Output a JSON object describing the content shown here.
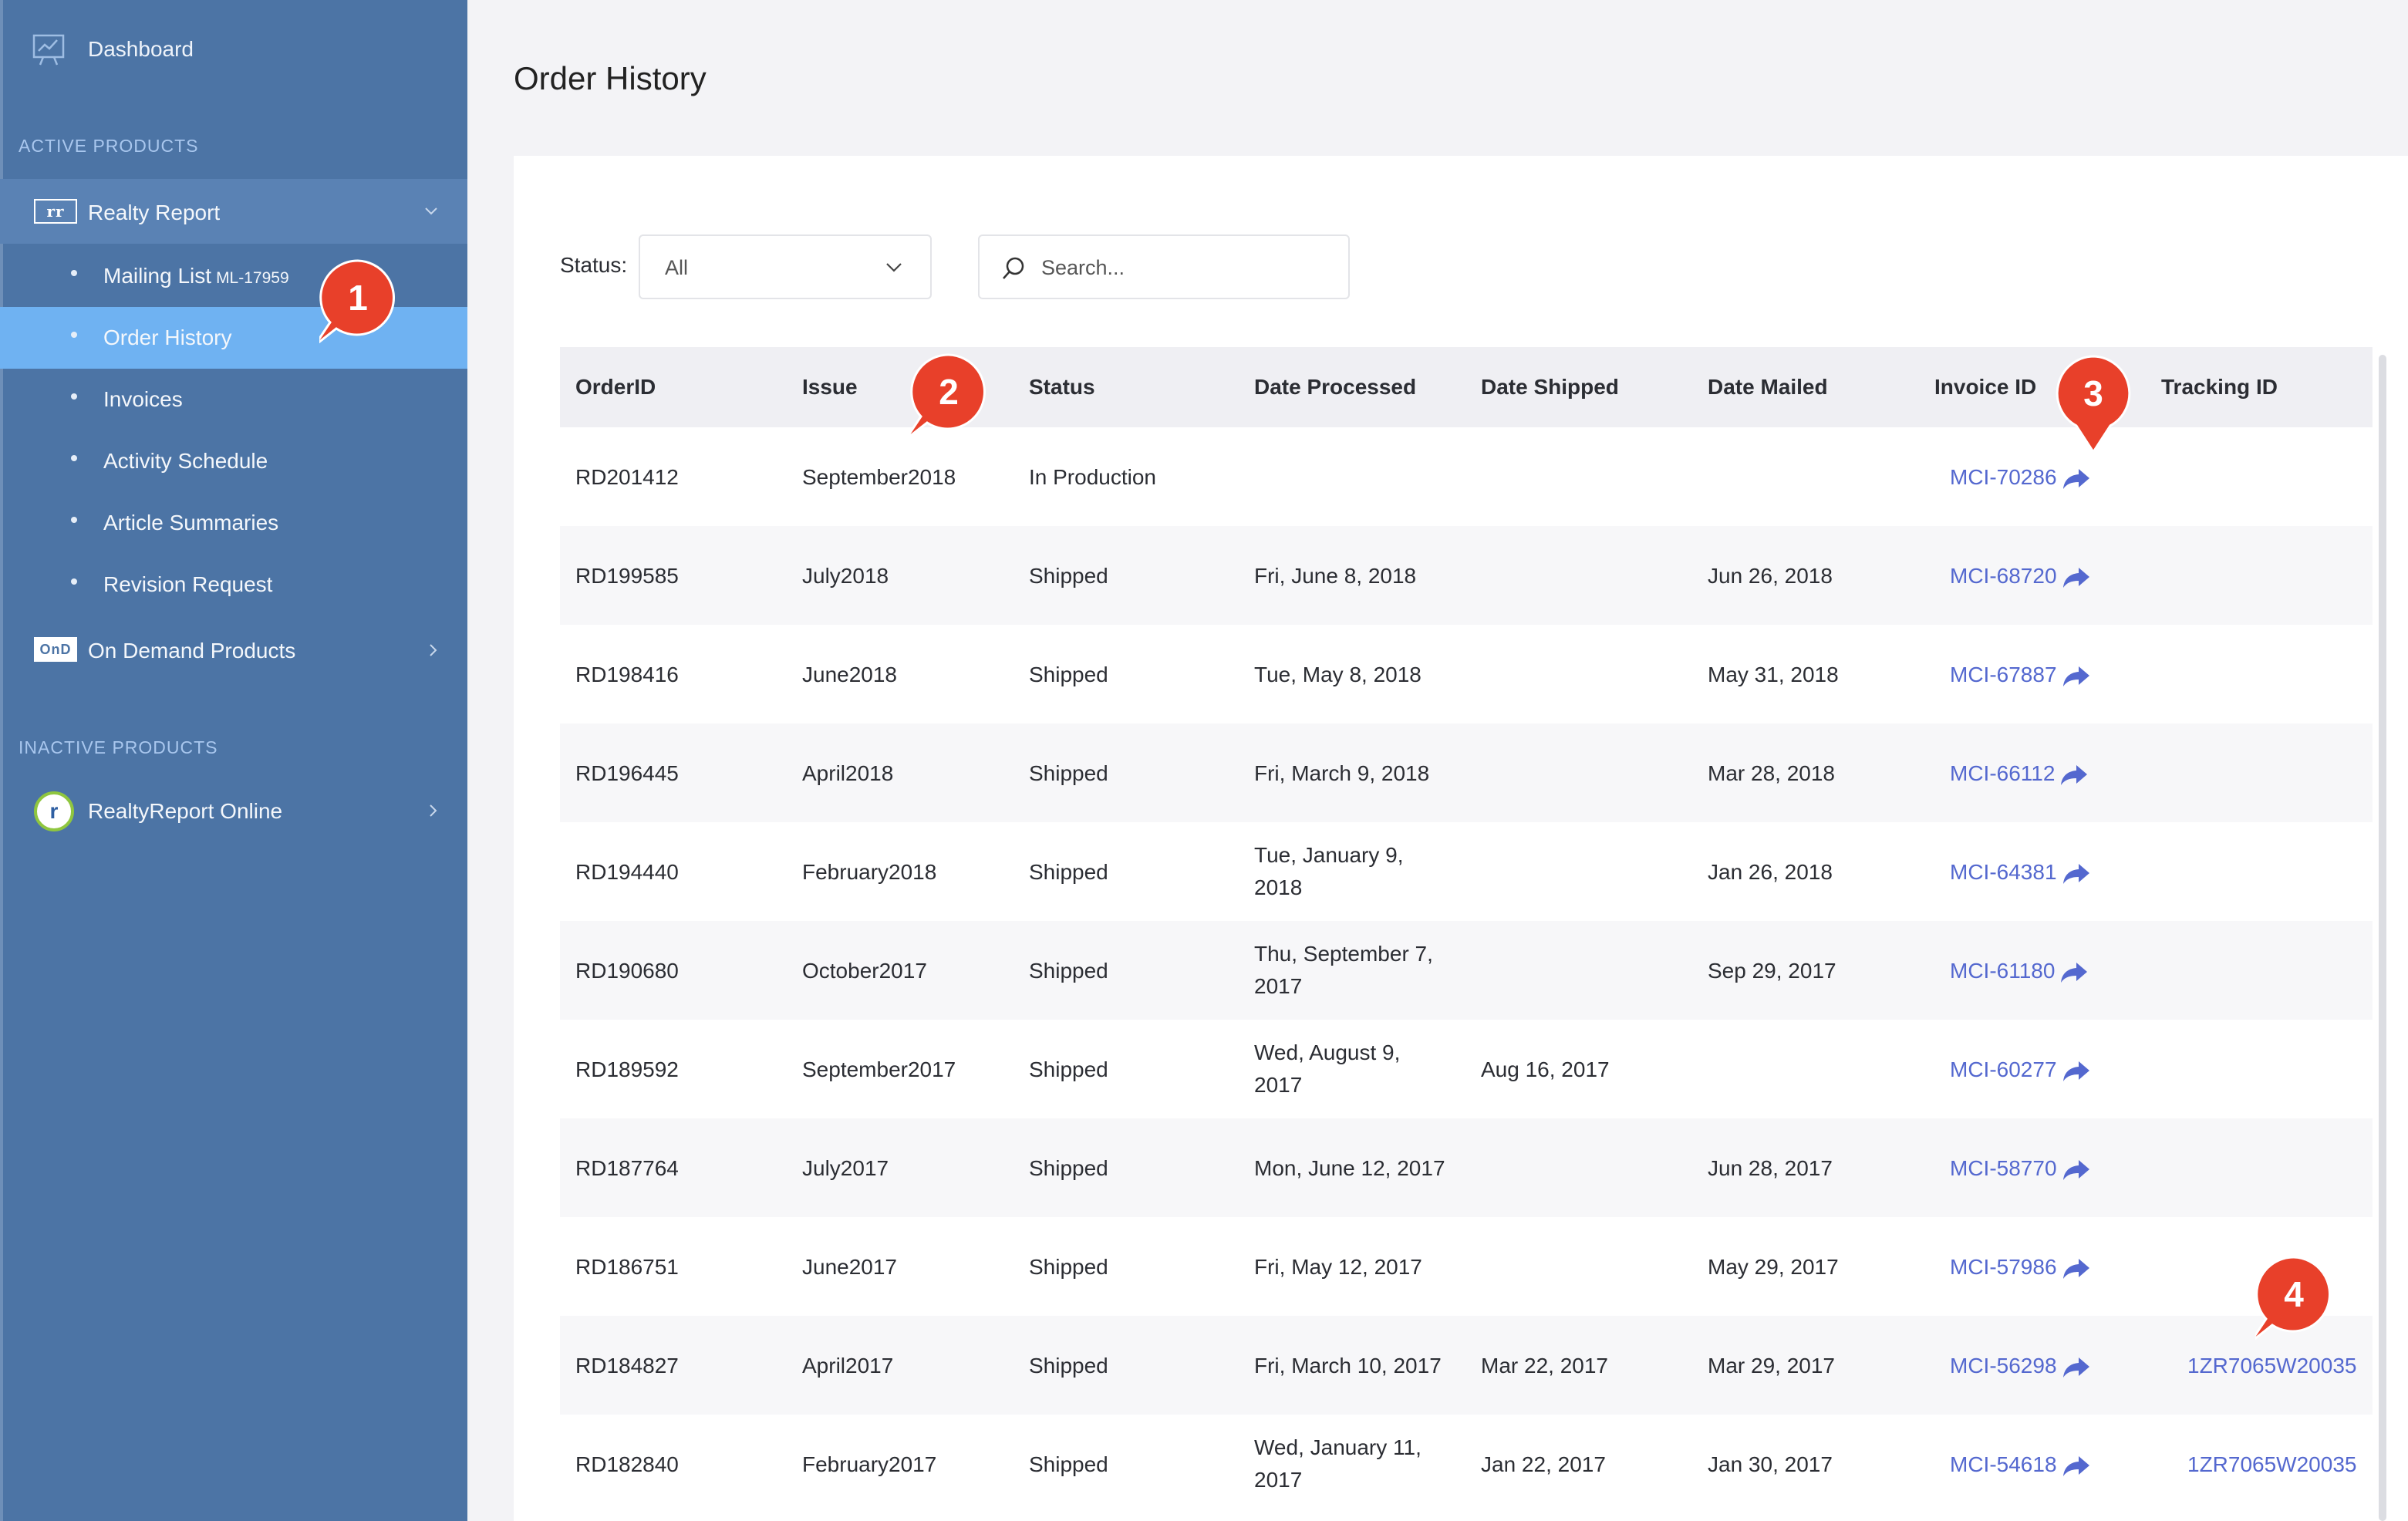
{
  "sidebar": {
    "dashboard_label": "Dashboard",
    "active_section": "ACTIVE PRODUCTS",
    "inactive_section": "INACTIVE PRODUCTS",
    "realty_report": {
      "badge": "rr",
      "label": "Realty Report"
    },
    "sub_items": [
      {
        "label": "Mailing List",
        "suffix": "ML-17959"
      },
      {
        "label": "Order History"
      },
      {
        "label": "Invoices"
      },
      {
        "label": "Activity Schedule"
      },
      {
        "label": "Article Summaries"
      },
      {
        "label": "Revision Request"
      }
    ],
    "on_demand": {
      "badge": "OnD",
      "label": "On Demand Products"
    },
    "realty_online": {
      "badge": "r",
      "label": "RealtyReport Online"
    }
  },
  "main": {
    "title": "Order History",
    "status_label": "Status:",
    "status_value": "All",
    "search_placeholder": "Search..."
  },
  "table": {
    "headers": [
      "OrderID",
      "Issue",
      "Status",
      "Date Processed",
      "Date Shipped",
      "Date Mailed",
      "Invoice ID",
      "Tracking ID"
    ],
    "rows": [
      {
        "order": "RD201412",
        "issue": "September2018",
        "status": "In Production",
        "processed_1": "",
        "processed_2": "",
        "shipped": "",
        "mailed": "",
        "invoice": "MCI-70286",
        "tracking": ""
      },
      {
        "order": "RD199585",
        "issue": "July2018",
        "status": "Shipped",
        "processed_1": "Fri, June 8, 2018",
        "processed_2": "",
        "shipped": "",
        "mailed": "Jun 26, 2018",
        "invoice": "MCI-68720",
        "tracking": ""
      },
      {
        "order": "RD198416",
        "issue": "June2018",
        "status": "Shipped",
        "processed_1": "Tue, May 8, 2018",
        "processed_2": "",
        "shipped": "",
        "mailed": "May 31, 2018",
        "invoice": "MCI-67887",
        "tracking": ""
      },
      {
        "order": "RD196445",
        "issue": "April2018",
        "status": "Shipped",
        "processed_1": "Fri, March 9, 2018",
        "processed_2": "",
        "shipped": "",
        "mailed": "Mar 28, 2018",
        "invoice": "MCI-66112",
        "tracking": ""
      },
      {
        "order": "RD194440",
        "issue": "February2018",
        "status": "Shipped",
        "processed_1": "Tue, January 9,",
        "processed_2": "2018",
        "shipped": "",
        "mailed": "Jan 26, 2018",
        "invoice": "MCI-64381",
        "tracking": ""
      },
      {
        "order": "RD190680",
        "issue": "October2017",
        "status": "Shipped",
        "processed_1": "Thu, September 7,",
        "processed_2": "2017",
        "shipped": "",
        "mailed": "Sep 29, 2017",
        "invoice": "MCI-61180",
        "tracking": ""
      },
      {
        "order": "RD189592",
        "issue": "September2017",
        "status": "Shipped",
        "processed_1": "Wed, August 9,",
        "processed_2": "2017",
        "shipped": "Aug 16, 2017",
        "mailed": "",
        "invoice": "MCI-60277",
        "tracking": ""
      },
      {
        "order": "RD187764",
        "issue": "July2017",
        "status": "Shipped",
        "processed_1": "Mon, June 12, 2017",
        "processed_2": "",
        "shipped": "",
        "mailed": "Jun 28, 2017",
        "invoice": "MCI-58770",
        "tracking": ""
      },
      {
        "order": "RD186751",
        "issue": "June2017",
        "status": "Shipped",
        "processed_1": "Fri, May 12, 2017",
        "processed_2": "",
        "shipped": "",
        "mailed": "May 29, 2017",
        "invoice": "MCI-57986",
        "tracking": ""
      },
      {
        "order": "RD184827",
        "issue": "April2017",
        "status": "Shipped",
        "processed_1": "Fri, March 10, 2017",
        "processed_2": "",
        "shipped": "Mar 22, 2017",
        "mailed": "Mar 29, 2017",
        "invoice": "MCI-56298",
        "tracking": "1ZR7065W20035"
      },
      {
        "order": "RD182840",
        "issue": "February2017",
        "status": "Shipped",
        "processed_1": "Wed, January 11,",
        "processed_2": "2017",
        "shipped": "Jan 22, 2017",
        "mailed": "Jan 30, 2017",
        "invoice": "MCI-54618",
        "tracking": "1ZR7065W20035"
      }
    ]
  },
  "callouts": [
    "1",
    "2",
    "3",
    "4"
  ],
  "colors": {
    "sidebar": "#4c74a5",
    "sidebar_active": "#6fb2f2",
    "link": "#5468cf",
    "callout": "#e8402a"
  },
  "icons": {
    "dashboard": "dashboard-chart-icon",
    "expand": "chevron-down-icon",
    "collapse": "chevron-right-icon",
    "select": "chevron-down-icon",
    "search": "search-icon",
    "invoice": "share-arrow-icon"
  }
}
